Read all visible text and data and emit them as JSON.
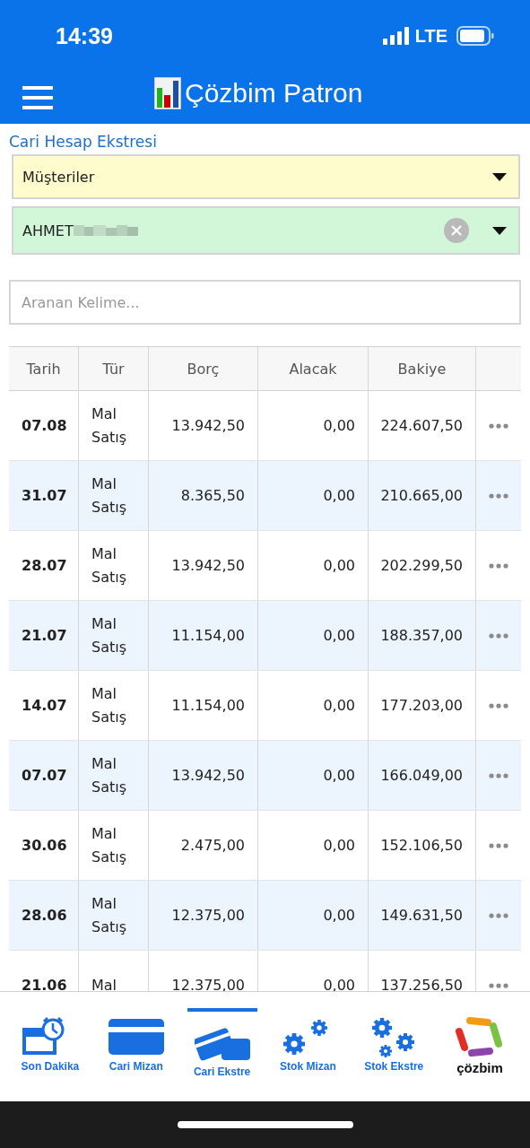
{
  "status_bar": {
    "time": "14:39",
    "network": "LTE"
  },
  "app_bar": {
    "title": "Çözbim Patron"
  },
  "page_title": "Cari Hesap Ekstresi",
  "account_type": {
    "value": "Müşteriler"
  },
  "account": {
    "value": "AHMET"
  },
  "search": {
    "placeholder": "Aranan Kelime..."
  },
  "table": {
    "columns": [
      "Tarih",
      "Tür",
      "Borç",
      "Alacak",
      "Bakiye"
    ],
    "rows": [
      {
        "date": "07.08",
        "type": "Mal Satış",
        "debit": "13.942,50",
        "credit": "0,00",
        "balance": "224.607,50"
      },
      {
        "date": "31.07",
        "type": "Mal Satış",
        "debit": "8.365,50",
        "credit": "0,00",
        "balance": "210.665,00"
      },
      {
        "date": "28.07",
        "type": "Mal Satış",
        "debit": "13.942,50",
        "credit": "0,00",
        "balance": "202.299,50"
      },
      {
        "date": "21.07",
        "type": "Mal Satış",
        "debit": "11.154,00",
        "credit": "0,00",
        "balance": "188.357,00"
      },
      {
        "date": "14.07",
        "type": "Mal Satış",
        "debit": "11.154,00",
        "credit": "0,00",
        "balance": "177.203,00"
      },
      {
        "date": "07.07",
        "type": "Mal Satış",
        "debit": "13.942,50",
        "credit": "0,00",
        "balance": "166.049,00"
      },
      {
        "date": "30.06",
        "type": "Mal Satış",
        "debit": "2.475,00",
        "credit": "0,00",
        "balance": "152.106,50"
      },
      {
        "date": "28.06",
        "type": "Mal Satış",
        "debit": "12.375,00",
        "credit": "0,00",
        "balance": "149.631,50"
      },
      {
        "date": "21.06",
        "type": "Mal",
        "debit": "12.375,00",
        "credit": "0,00",
        "balance": "137.256,50"
      }
    ]
  },
  "tab_bar": [
    {
      "label": "Son Dakika",
      "kind": "clock",
      "selected": false
    },
    {
      "label": "Cari Mizan",
      "kind": "card",
      "selected": false
    },
    {
      "label": "Cari Ekstre",
      "kind": "cards",
      "selected": true
    },
    {
      "label": "Stok Mizan",
      "kind": "gears",
      "selected": false
    },
    {
      "label": "Stok Ekstre",
      "kind": "gears3",
      "selected": false
    },
    {
      "label": "çözbim",
      "kind": "logo",
      "selected": false
    }
  ]
}
